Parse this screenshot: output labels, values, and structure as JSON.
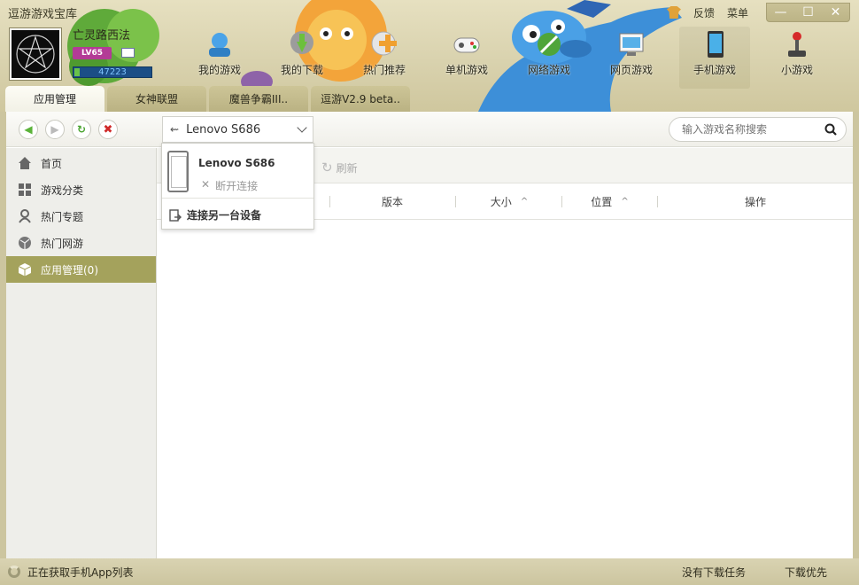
{
  "window": {
    "title": "逗游游戏宝库"
  },
  "topright": {
    "feedback": "反馈",
    "menu": "菜单",
    "minimize": "—",
    "maximize": "☐",
    "close": "✕"
  },
  "user": {
    "name": "亡灵路西法",
    "level": "LV65",
    "points": "47223"
  },
  "nav": [
    {
      "label": "我的游戏",
      "icon": "my-games-icon"
    },
    {
      "label": "我的下载",
      "icon": "download-icon"
    },
    {
      "label": "热门推荐",
      "icon": "hot-recommend-icon"
    },
    {
      "label": "单机游戏",
      "icon": "gamepad-icon"
    },
    {
      "label": "网络游戏",
      "icon": "network-game-icon"
    },
    {
      "label": "网页游戏",
      "icon": "web-game-icon"
    },
    {
      "label": "手机游戏",
      "icon": "mobile-game-icon"
    },
    {
      "label": "小游戏",
      "icon": "joystick-icon"
    }
  ],
  "tabs": [
    "应用管理",
    "女神联盟",
    "魔兽争霸III..",
    "逗游V2.9 beta.."
  ],
  "toolbar": {
    "device": "Lenovo S686",
    "search_placeholder": "输入游戏名称搜索"
  },
  "sidebar": [
    {
      "label": "首页",
      "icon": "home-icon"
    },
    {
      "label": "游戏分类",
      "icon": "grid-icon"
    },
    {
      "label": "热门专题",
      "icon": "topic-icon"
    },
    {
      "label": "热门网游",
      "icon": "globe-icon"
    },
    {
      "label": "应用管理(0)",
      "icon": "box-icon",
      "active": true
    }
  ],
  "content": {
    "refresh": "刷新",
    "columns": [
      "版本",
      "大小",
      "位置",
      "操作"
    ]
  },
  "dropdown": {
    "device_name": "Lenovo S686",
    "disconnect": "断开连接",
    "connect_other": "连接另一台设备"
  },
  "status": {
    "left": "正在获取手机App列表",
    "no_task": "没有下载任务",
    "priority": "下载优先"
  },
  "colors": {
    "header": "#d9d2ae",
    "sidebar_active": "#a4a25c",
    "status": "#d4cda9"
  }
}
